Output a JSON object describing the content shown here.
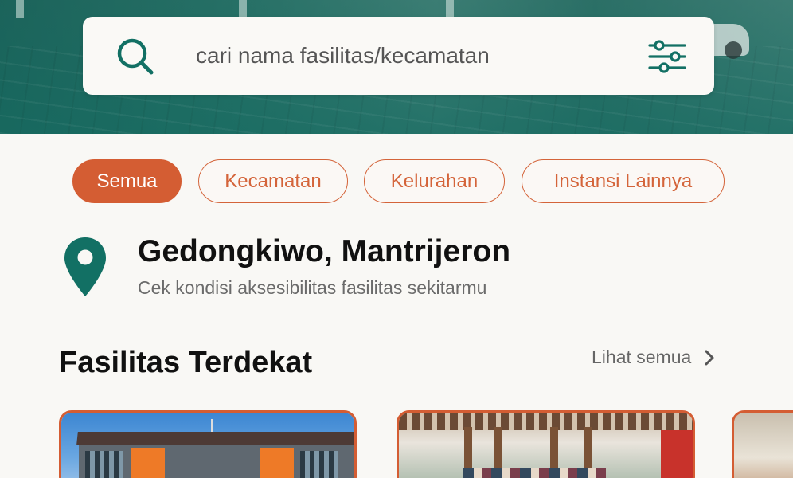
{
  "search": {
    "placeholder": "cari nama fasilitas/kecamatan"
  },
  "filters": [
    {
      "label": "Semua",
      "active": true
    },
    {
      "label": "Kecamatan",
      "active": false
    },
    {
      "label": "Kelurahan",
      "active": false
    },
    {
      "label": "Instansi Lainnya",
      "active": false
    }
  ],
  "location": {
    "title": "Gedongkiwo, Mantrijeron",
    "subtitle": "Cek kondisi aksesibilitas fasilitas sekitarmu"
  },
  "nearby": {
    "title": "Fasilitas Terdekat",
    "see_all": "Lihat semua"
  },
  "colors": {
    "accent": "#d45d33",
    "teal": "#127064",
    "background": "#f9f8f5"
  },
  "icons": {
    "search": "search-icon",
    "filter": "filter-sliders-icon",
    "location": "location-pin-icon",
    "chevron": "chevron-right-icon"
  }
}
